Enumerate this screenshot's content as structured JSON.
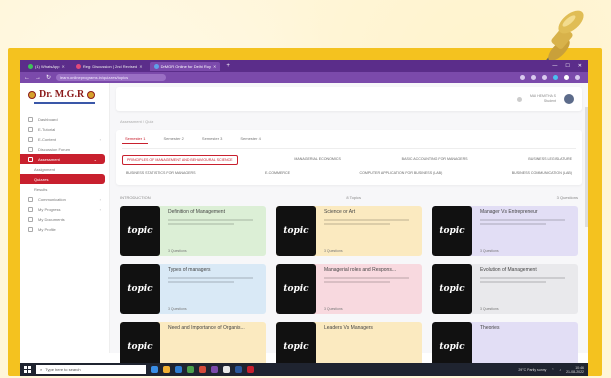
{
  "browser": {
    "tabs": [
      {
        "label": "(1) WhatsApp",
        "active": false,
        "color": "#3ec15a"
      },
      {
        "label": "Reg: Discussion | 2nd Revised",
        "active": false,
        "color": "#e34a7a"
      },
      {
        "label": "DrMGR Online for Delhi Roy",
        "active": true,
        "color": "#5fa1e8"
      }
    ],
    "url": "learn.onlineprograms.in/quizzes/topics"
  },
  "sidebar": {
    "logo": "Dr. M.G.R",
    "items": [
      {
        "label": "Dashboard"
      },
      {
        "label": "E-Tutorial"
      },
      {
        "label": "E-Content"
      },
      {
        "label": "Discussion Forum"
      },
      {
        "label": "Assessment",
        "open": true
      },
      {
        "label": "Assignment",
        "sub": true
      },
      {
        "label": "Quizzes",
        "sub": true,
        "active": true
      },
      {
        "label": "Results",
        "sub": true
      },
      {
        "label": "Communication"
      },
      {
        "label": "My Progress"
      },
      {
        "label": "My Documents"
      },
      {
        "label": "My Profile"
      }
    ]
  },
  "topbar": {
    "user_name": "MAI HEMITHA S",
    "user_role": "Student"
  },
  "breadcrumb": "Assessment / Quiz",
  "semesters": [
    "Semester 1",
    "Semester 2",
    "Semester 3",
    "Semester 4"
  ],
  "subjects_row1": [
    "PRINCIPLES OF MANAGEMENT AND BEHAVIOURAL SCIENCE",
    "MANAGERIAL ECONOMICS",
    "BASIC ACCOUNTING FOR MANAGERS",
    "BUSINESS LEGISLATURE"
  ],
  "subjects_row2": [
    "BUSINESS STATISTICS FOR MANAGERS",
    "E-COMMERCE",
    "COMPUTER APPLICATION FOR BUSINESS (LAB)",
    "BUSINESS COMMUNICATION (LAB)"
  ],
  "section": {
    "left": "INTRODUCTION",
    "middle": "8 Topics",
    "right": "3 Questions"
  },
  "topics": [
    {
      "title": "Definition of Management",
      "foot": "3 Questions",
      "color": "green"
    },
    {
      "title": "Science or Art",
      "foot": "3 Questions",
      "color": "yellow"
    },
    {
      "title": "Manager Vs Entrepreneur",
      "foot": "3 Questions",
      "color": "lav"
    },
    {
      "title": "Types of managers",
      "foot": "3 Questions",
      "color": "blue"
    },
    {
      "title": "Managerial roles and Respons...",
      "foot": "3 Questions",
      "color": "pink"
    },
    {
      "title": "Evolution of Management",
      "foot": "3 Questions",
      "color": "grey"
    },
    {
      "title": "Need and Importance of Organis...",
      "foot": "",
      "color": "yellow"
    },
    {
      "title": "Leaders Vs Managers",
      "foot": "",
      "color": "yellow"
    },
    {
      "title": "Theories",
      "foot": "",
      "color": "lav"
    }
  ],
  "topic_img_text": "topic",
  "taskbar": {
    "search_placeholder": "Type here to search",
    "weather": "29°C Partly sunny",
    "time": "10:46",
    "date": "21-08-2022"
  },
  "colors": {
    "frame": "#f4c21f",
    "browser": "#5b2d8a",
    "accent": "#c8202e"
  }
}
